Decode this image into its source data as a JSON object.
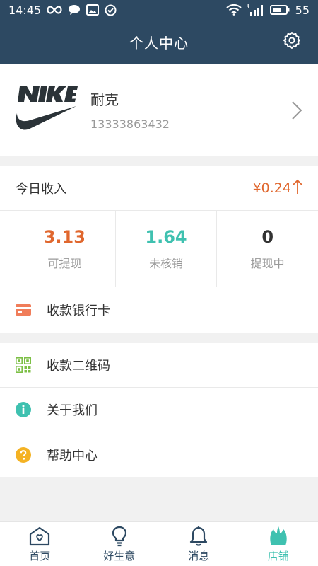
{
  "status_bar": {
    "time": "14:45",
    "battery": "55"
  },
  "header": {
    "title": "个人中心"
  },
  "profile": {
    "name": "耐克",
    "phone": "13333863432"
  },
  "income": {
    "label": "今日收入",
    "value": "¥0.24",
    "stats": [
      {
        "value": "3.13",
        "label": "可提现",
        "color": "#e0672e"
      },
      {
        "value": "1.64",
        "label": "未核销",
        "color": "#3fc1b0"
      },
      {
        "value": "0",
        "label": "提现中",
        "color": "#333333"
      }
    ]
  },
  "bank_card": {
    "label": "收款银行卡"
  },
  "menu": [
    {
      "label": "收款二维码",
      "icon": "qr-code-icon"
    },
    {
      "label": "关于我们",
      "icon": "info-icon"
    },
    {
      "label": "帮助中心",
      "icon": "help-icon"
    }
  ],
  "tabs": [
    {
      "label": "首页",
      "icon": "home-icon"
    },
    {
      "label": "好生意",
      "icon": "bulb-icon"
    },
    {
      "label": "消息",
      "icon": "bell-icon"
    },
    {
      "label": "店铺",
      "icon": "shop-icon",
      "active": true
    }
  ],
  "colors": {
    "header_bg": "#2d4962",
    "accent_orange": "#e0672e",
    "accent_teal": "#3fc1b0"
  }
}
